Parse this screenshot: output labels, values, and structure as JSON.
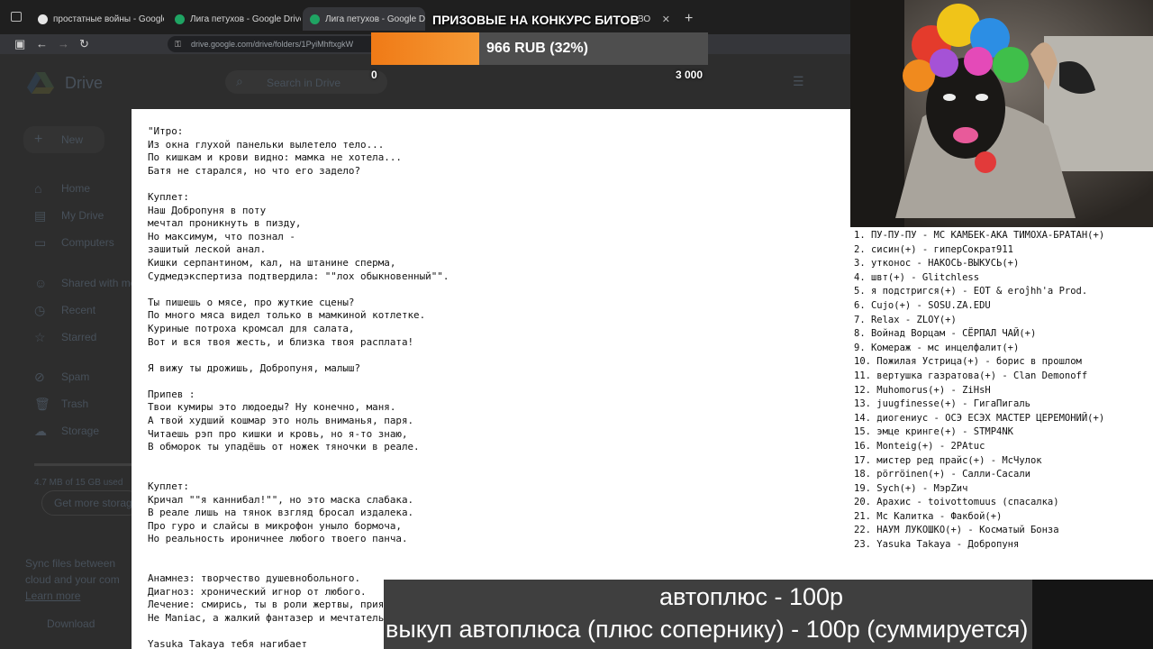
{
  "browser": {
    "tabs": [
      {
        "title": "простатные войны - Google Sheets",
        "favicon_color": "#e6e6e6"
      },
      {
        "title": "Лига петухов - Google Drive",
        "favicon_color": "#1fa463"
      },
      {
        "title": "Лига петухов - Google Drive",
        "favicon_color": "#1fa463"
      }
    ],
    "hidden_tab_partial": "ВО",
    "url": "drive.google.com/drive/folders/1PyiMhftxgkW"
  },
  "drive": {
    "logo_text": "Drive",
    "search_placeholder": "Search in Drive",
    "new_label": "New",
    "nav": [
      "Home",
      "My Drive",
      "Computers",
      "Shared with me",
      "Recent",
      "Starred",
      "Spam",
      "Trash",
      "Storage"
    ],
    "storage_used": "4.7 MB of 15 GB used",
    "get_more": "Get more storage",
    "sync_text": [
      "Sync files between",
      "cloud and your com",
      "Learn more"
    ],
    "download": "Download"
  },
  "document": {
    "lines": [
      "\"Итро:",
      "Из окна глухой панельки вылетело тело...",
      "По кишкам и крови видно: мамка не хотела...",
      "Батя не старался, но что его задело?",
      "",
      "Куплет:",
      "Наш Добропуня в поту",
      "мечтал проникнуть в пизду,",
      "Но максимум, что познал -",
      "зашитый леской анал.",
      "Кишки серпантином, кал, на штанине сперма,",
      "Судмедэкспертиза подтвердила: \"\"лох обыкновенный\"\".",
      "",
      "Ты пишешь о мясе, про жуткие сцены?",
      "По много мяса видел только в мамкиной котлетке.",
      "Куриные потроха кромсал для салата,",
      "Вот и вся твоя жесть, и близка твоя расплата!",
      "",
      "Я вижу ты дрожишь, Добропуня, малыш?",
      "",
      "Припев :",
      "Твои кумиры это людоеды? Ну конечно, маня.",
      "А твой худший кошмар это ноль вниманья, паря.",
      "Читаешь рэп про кишки и кровь, но я-то знаю,",
      "В обморок ты упадёшь от ножек тяночки в реале.",
      "",
      "",
      "Куплет:",
      "Кричал \"\"я каннибал!\"\", но это маска слабака.",
      "В реале лишь на тянок взгляд бросал издалека.",
      "Про гуро и слайсы в микрофон уныло бормоча,",
      "Но реальность ироничнее любого твоего панча.",
      "",
      "",
      "Анамнез: творчество душевнобольного.",
      "Диагноз: хронический игнор от любого.",
      "Лечение: смирись, ты в роли жертвы, приятель.",
      "Не Maniac, а жалкий фантазер и мечтатель.",
      "",
      "Yasuka Takaya тебя нагибает"
    ]
  },
  "progress": {
    "title": "ПРИЗОВЫЕ НА КОНКУРС БИТОВ",
    "label": "966 RUB (32%)",
    "fraction": 0.32,
    "min": "0",
    "max": "3 000",
    "fill_color": "#f07a16"
  },
  "participants": [
    "1. ПУ-ПУ-ПУ - МС КАМБЕК-АКА ТИМОХА-БРАТАН(+)",
    "2. сисин(+) - гиперСократ911",
    "3. утконос - НАКОСЬ-ВЫКУСЬ(+)",
    "4. швт(+) - Glitchless",
    "5. я подстригся(+) - EOT & eroĵhh'a Prod.",
    "6. Cujo(+) - SOSU.ZA.EDU",
    "7. Relax - ZLOY(+)",
    "8. Войнад Ворцам - СЁРПАЛ ЧАЙ(+)",
    "9. Комераж - мс инцелфалит(+)",
    "10. Пожилая Устрица(+) - борис в прошлом",
    "11. вертушка газратова(+) - Clan Demonoff",
    "12. Muhomorus(+) - ZiHsH",
    "13. juugfinesse(+) - ГигаПигаль",
    "14. диогениус - ОСЭ ЕСЭХ МАСТЕР ЦЕРЕМОНИЙ(+)",
    "15. эмце кринге(+) - STMP4NK",
    "16. Monteig(+) - 2PAtuc",
    "17. мистер ред прайс(+) - МсЧулок",
    "18. pörröinen(+) - Салли-Сасали",
    "19. Sych(+) - МэрZич",
    "20. Арахис - toivottomuus (спасалка)",
    "21. Мс Калитка - Факбой(+)",
    "22. НАУМ ЛУКОШКО(+) - Косматый Бонза",
    "23. Yasuka Takaya - Добропуня"
  ],
  "captions": {
    "line1": "автоплюс - 100р",
    "line2": "выкуп автоплюса (плюс сопернику) - 100р (суммируется)"
  }
}
